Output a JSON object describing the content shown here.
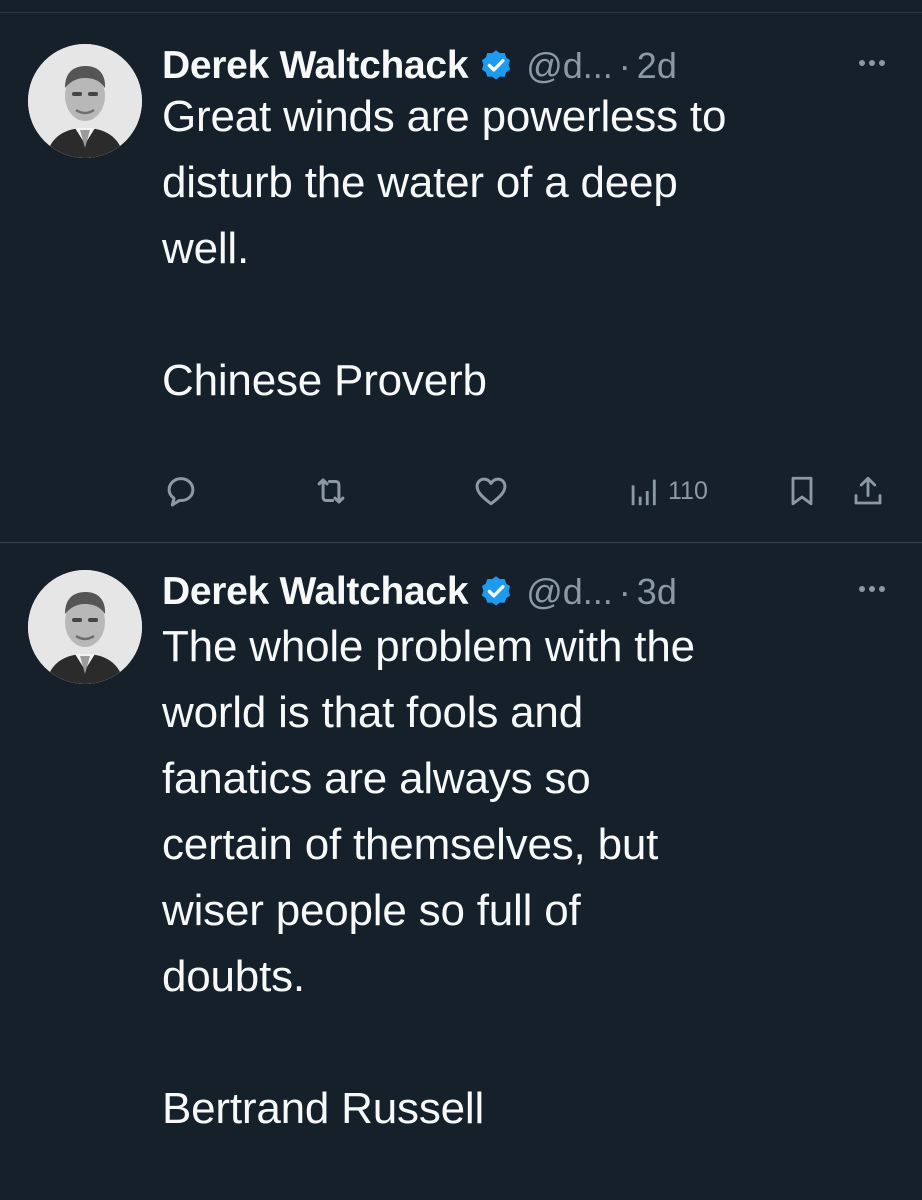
{
  "tweets": [
    {
      "author": {
        "display_name": "Derek Waltchack",
        "handle": "@d...",
        "avatar_icon": "profile-photo"
      },
      "separator": "·",
      "timestamp": "2d",
      "text": "Great winds are powerless to\ndisturb the water of a deep\nwell.\n\nChinese Proverb",
      "actions": {
        "views_count": "110"
      }
    },
    {
      "author": {
        "display_name": "Derek Waltchack",
        "handle": "@d...",
        "avatar_icon": "profile-photo"
      },
      "separator": "·",
      "timestamp": "3d",
      "text": "The whole problem with the\nworld is that fools and\nfanatics are always so\ncertain of themselves, but\nwiser people so full of\ndoubts.\n\nBertrand Russell"
    }
  ],
  "colors": {
    "background": "#15202b",
    "text": "#f7f9f9",
    "muted": "#8b98a5",
    "verified": "#1d9bf0",
    "divider": "#38444d"
  }
}
